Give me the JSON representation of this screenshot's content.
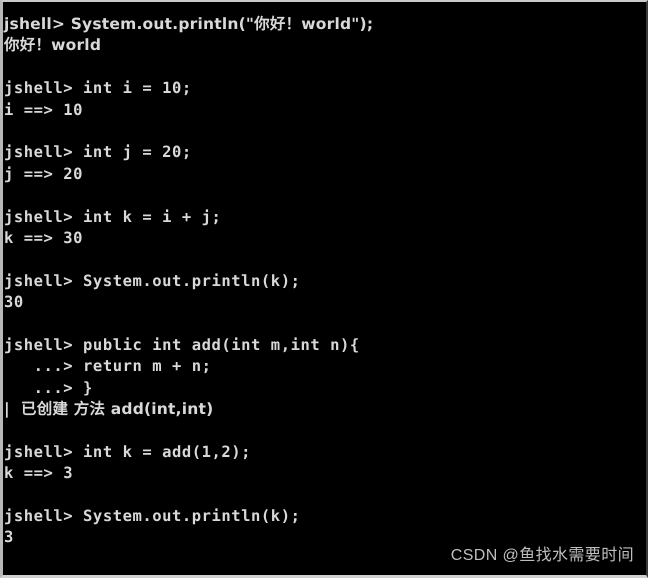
{
  "window": {
    "title": "jshell",
    "background_color": "#000000",
    "text_color": "#d9d9d9",
    "border_color": "#c9c9c9"
  },
  "terminal": {
    "prompt": "jshell>",
    "continuation_prompt": "...>",
    "lines": [
      {
        "text": "jshell> System.out.println(\"你好！world\");",
        "kind": "input",
        "cjk": true
      },
      {
        "text": "你好！world",
        "kind": "output",
        "cjk": true
      },
      {
        "text": "",
        "kind": "blank",
        "cjk": false
      },
      {
        "text": "jshell> int i = 10;",
        "kind": "input",
        "cjk": false
      },
      {
        "text": "i ==> 10",
        "kind": "output",
        "cjk": false
      },
      {
        "text": "",
        "kind": "blank",
        "cjk": false
      },
      {
        "text": "jshell> int j = 20;",
        "kind": "input",
        "cjk": false
      },
      {
        "text": "j ==> 20",
        "kind": "output",
        "cjk": false
      },
      {
        "text": "",
        "kind": "blank",
        "cjk": false
      },
      {
        "text": "jshell> int k = i + j;",
        "kind": "input",
        "cjk": false
      },
      {
        "text": "k ==> 30",
        "kind": "output",
        "cjk": false
      },
      {
        "text": "",
        "kind": "blank",
        "cjk": false
      },
      {
        "text": "jshell> System.out.println(k);",
        "kind": "input",
        "cjk": false
      },
      {
        "text": "30",
        "kind": "output",
        "cjk": false
      },
      {
        "text": "",
        "kind": "blank",
        "cjk": false
      },
      {
        "text": "jshell> public int add(int m,int n){",
        "kind": "input",
        "cjk": false
      },
      {
        "text": "   ...> return m + n;",
        "kind": "continuation",
        "cjk": false
      },
      {
        "text": "   ...> }",
        "kind": "continuation",
        "cjk": false
      },
      {
        "text": "|  已创建 方法 add(int,int)",
        "kind": "message",
        "cjk": true
      },
      {
        "text": "",
        "kind": "blank",
        "cjk": false
      },
      {
        "text": "jshell> int k = add(1,2);",
        "kind": "input",
        "cjk": false
      },
      {
        "text": "k ==> 3",
        "kind": "output",
        "cjk": false
      },
      {
        "text": "",
        "kind": "blank",
        "cjk": false
      },
      {
        "text": "jshell> System.out.println(k);",
        "kind": "input",
        "cjk": false
      },
      {
        "text": "3",
        "kind": "output",
        "cjk": false
      }
    ]
  },
  "watermark": {
    "text": "CSDN @鱼找水需要时间"
  }
}
